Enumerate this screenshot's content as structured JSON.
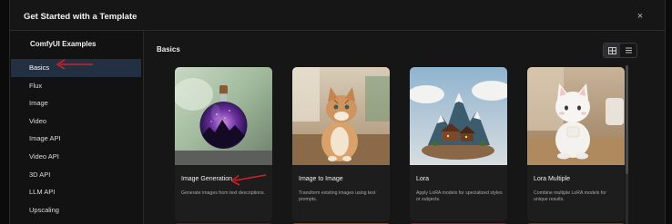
{
  "dialog": {
    "title": "Get Started with a Template",
    "close_label": "×"
  },
  "sidebar": {
    "title": "ComfyUI Examples",
    "items": [
      {
        "label": "Basics"
      },
      {
        "label": "Flux"
      },
      {
        "label": "Image"
      },
      {
        "label": "Video"
      },
      {
        "label": "Image API"
      },
      {
        "label": "Video API"
      },
      {
        "label": "3D API"
      },
      {
        "label": "LLM API"
      },
      {
        "label": "Upscaling"
      }
    ],
    "selected": "Basics"
  },
  "main": {
    "section_title": "Basics",
    "view_toggle": {
      "grid_icon": "grid-icon",
      "list_icon": "list-icon",
      "active": "grid"
    },
    "cards": [
      {
        "title": "Image Generation",
        "description": "Generate images from text descriptions.",
        "thumbnail": "bottle-galaxy-thumbnail"
      },
      {
        "title": "Image to Image",
        "description": "Transform existing images using text prompts.",
        "thumbnail": "cat-thumbnail"
      },
      {
        "title": "Lora",
        "description": "Apply LoRA models for specialized styles or subjects.",
        "thumbnail": "mountain-village-thumbnail"
      },
      {
        "title": "Lora Multiple",
        "description": "Combine multiple LoRA models for unique results.",
        "thumbnail": "white-cat-figurine-thumbnail"
      }
    ]
  },
  "colors": {
    "background": "#0b0b0c",
    "dialog": "#161617",
    "sidebar_active": "#223041",
    "card": "#1d1d1e",
    "annotation_arrow": "#d21f2b"
  }
}
